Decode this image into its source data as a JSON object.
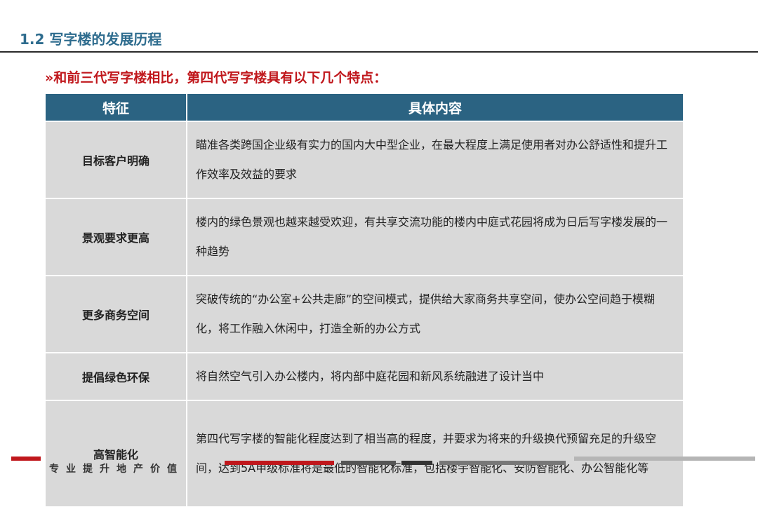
{
  "header": {
    "title": "1.2 写字楼的发展历程"
  },
  "subtitle": "»和前三代写字楼相比，第四代写字楼具有以下几个特点：",
  "table": {
    "headers": [
      "特征",
      "具体内容"
    ],
    "rows": [
      {
        "feature": "目标客户明确",
        "content": "瞄准各类跨国企业级有实力的国内大中型企业，在最大程度上满足使用者对办公舒适性和提升工作效率及效益的要求"
      },
      {
        "feature": "景观要求更高",
        "content": "楼内的绿色景观也越来越受欢迎，有共享交流功能的楼内中庭式花园将成为日后写字楼发展的一种趋势"
      },
      {
        "feature": "更多商务空间",
        "content": "突破传统的“办公室+公共走廊”的空间模式，提供给大家商务共享空间，使办公空间趋于模糊化，将工作融入休闲中，打造全新的办公方式"
      },
      {
        "feature": "提倡绿色环保",
        "content": "将自然空气引入办公楼内，将内部中庭花园和新风系统融进了设计当中"
      },
      {
        "feature": "高智能化",
        "content": "第四代写字楼的智能化程度达到了相当高的程度，并要求为将来的升级换代预留充足的升级空间，达到5A甲级标准将是最低的智能化标准，包括楼宇智能化、安防智能化、办公智能化等"
      }
    ]
  },
  "footer": {
    "slogan": "专业提升地产价值"
  },
  "colors": {
    "title": "#2e6c8e",
    "subtitle": "#c0171c",
    "header_bg": "#2b6382",
    "cell_bg": "#d9d9d9",
    "footer_red": "#c0171c"
  }
}
